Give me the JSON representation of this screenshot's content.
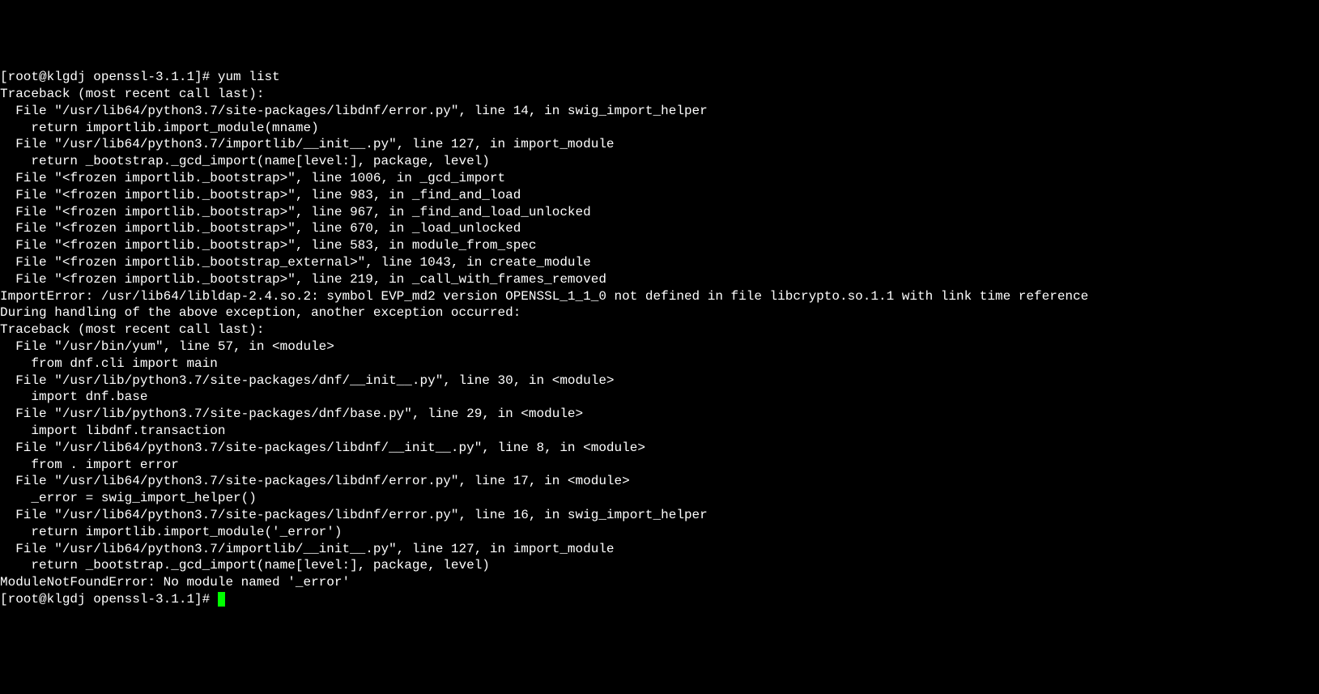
{
  "terminal": {
    "lines": [
      "[root@klgdj openssl-3.1.1]# yum list",
      "Traceback (most recent call last):",
      "  File \"/usr/lib64/python3.7/site-packages/libdnf/error.py\", line 14, in swig_import_helper",
      "    return importlib.import_module(mname)",
      "  File \"/usr/lib64/python3.7/importlib/__init__.py\", line 127, in import_module",
      "    return _bootstrap._gcd_import(name[level:], package, level)",
      "  File \"<frozen importlib._bootstrap>\", line 1006, in _gcd_import",
      "  File \"<frozen importlib._bootstrap>\", line 983, in _find_and_load",
      "  File \"<frozen importlib._bootstrap>\", line 967, in _find_and_load_unlocked",
      "  File \"<frozen importlib._bootstrap>\", line 670, in _load_unlocked",
      "  File \"<frozen importlib._bootstrap>\", line 583, in module_from_spec",
      "  File \"<frozen importlib._bootstrap_external>\", line 1043, in create_module",
      "  File \"<frozen importlib._bootstrap>\", line 219, in _call_with_frames_removed",
      "ImportError: /usr/lib64/libldap-2.4.so.2: symbol EVP_md2 version OPENSSL_1_1_0 not defined in file libcrypto.so.1.1 with link time reference",
      "",
      "During handling of the above exception, another exception occurred:",
      "",
      "Traceback (most recent call last):",
      "  File \"/usr/bin/yum\", line 57, in <module>",
      "    from dnf.cli import main",
      "  File \"/usr/lib/python3.7/site-packages/dnf/__init__.py\", line 30, in <module>",
      "    import dnf.base",
      "  File \"/usr/lib/python3.7/site-packages/dnf/base.py\", line 29, in <module>",
      "    import libdnf.transaction",
      "  File \"/usr/lib64/python3.7/site-packages/libdnf/__init__.py\", line 8, in <module>",
      "    from . import error",
      "  File \"/usr/lib64/python3.7/site-packages/libdnf/error.py\", line 17, in <module>",
      "    _error = swig_import_helper()",
      "  File \"/usr/lib64/python3.7/site-packages/libdnf/error.py\", line 16, in swig_import_helper",
      "    return importlib.import_module('_error')",
      "  File \"/usr/lib64/python3.7/importlib/__init__.py\", line 127, in import_module",
      "    return _bootstrap._gcd_import(name[level:], package, level)",
      "ModuleNotFoundError: No module named '_error'"
    ],
    "prompt": "[root@klgdj openssl-3.1.1]# "
  }
}
